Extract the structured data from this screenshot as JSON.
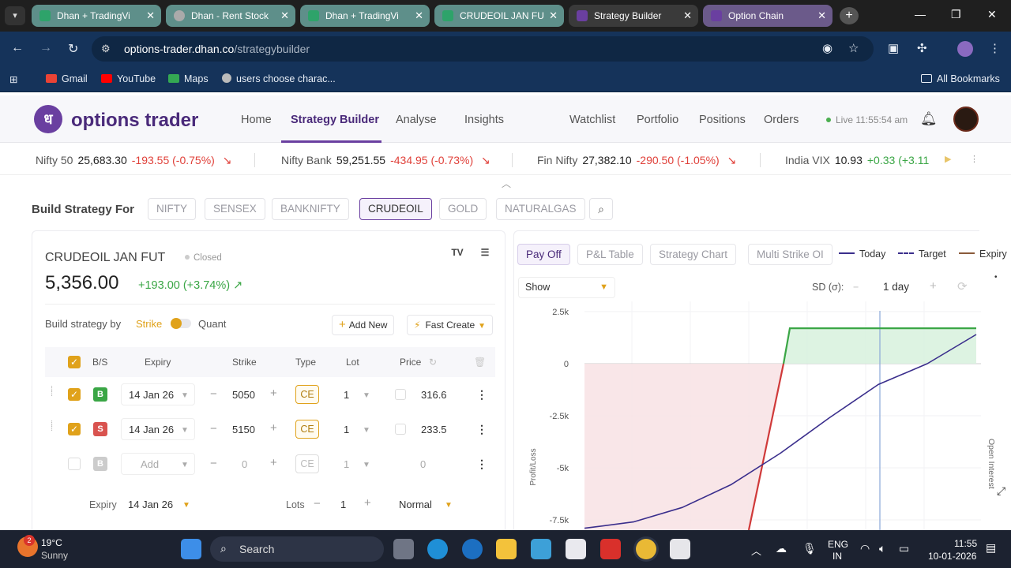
{
  "browser": {
    "tabs": [
      {
        "title": "Dhan + TradingVi",
        "active": false
      },
      {
        "title": "Dhan - Rent Stock",
        "active": false
      },
      {
        "title": "Dhan + TradingVi",
        "active": false
      },
      {
        "title": "CRUDEOIL JAN FU",
        "active": false
      },
      {
        "title": "Strategy Builder",
        "active": true
      },
      {
        "title": "Option Chain",
        "active": false
      }
    ],
    "url_host": "options-trader.dhan.co",
    "url_path": "/strategybuilder",
    "bookmarks": [
      "Gmail",
      "YouTube",
      "Maps",
      "users choose charac..."
    ],
    "all_bookmarks": "All Bookmarks"
  },
  "app": {
    "logo_mark": "ध",
    "logo_text": "options trader",
    "nav": [
      "Home",
      "Strategy Builder",
      "Analyse",
      "Insights",
      "Watchlist",
      "Portfolio",
      "Positions",
      "Orders"
    ],
    "live_status": "Live 11:55:54 am"
  },
  "ticker": [
    {
      "name": "Nifty 50",
      "value": "25,683.30",
      "change": "-193.55 (-0.75%)",
      "dir": "down"
    },
    {
      "name": "Nifty Bank",
      "value": "59,251.55",
      "change": "-434.95 (-0.73%)",
      "dir": "down"
    },
    {
      "name": "Fin Nifty",
      "value": "27,382.10",
      "change": "-290.50 (-1.05%)",
      "dir": "down"
    },
    {
      "name": "India VIX",
      "value": "10.93",
      "change": "+0.33 (+3.11",
      "dir": "up"
    }
  ],
  "build": {
    "label": "Build Strategy For",
    "instruments": [
      "NIFTY",
      "SENSEX",
      "BANKNIFTY",
      "CRUDEOIL",
      "GOLD",
      "NATURALGAS"
    ],
    "selected": "CRUDEOIL"
  },
  "instrument": {
    "symbol": "CRUDEOIL JAN FUT",
    "status": "Closed",
    "ltp": "5,356.00",
    "change": "+193.00 (+3.74%)"
  },
  "builder": {
    "build_by_label": "Build strategy by",
    "mode_strike": "Strike",
    "mode_quant": "Quant",
    "add_new": "Add New",
    "fast_create": "Fast Create",
    "headers": [
      "B/S",
      "Expiry",
      "Strike",
      "Type",
      "Lot",
      "Price"
    ],
    "legs": [
      {
        "checked": true,
        "side": "B",
        "expiry": "14 Jan 26",
        "strike": "5050",
        "type": "CE",
        "lot": "1",
        "price": "316.6"
      },
      {
        "checked": true,
        "side": "S",
        "expiry": "14 Jan 26",
        "strike": "5150",
        "type": "CE",
        "lot": "1",
        "price": "233.5"
      },
      {
        "checked": false,
        "side": "B",
        "expiry": "Add",
        "strike": "0",
        "type": "CE",
        "lot": "1",
        "price": "0"
      }
    ],
    "footer": {
      "expiry_label": "Expiry",
      "expiry": "14 Jan 26",
      "lots_label": "Lots",
      "lots": "1",
      "order_type": "Normal"
    }
  },
  "payoff": {
    "tabs": [
      "Pay Off",
      "P&L Table",
      "Strategy Chart",
      "Multi Strike OI"
    ],
    "active_tab": "Pay Off",
    "legend": [
      "Today",
      "Target",
      "Expiry"
    ],
    "show_select": "Show",
    "sd_label": "SD (σ):",
    "sd_value": "1 day",
    "side_label": "Open Interest"
  },
  "chart_data": {
    "type": "line",
    "ylabel": "Profit/Loss",
    "y_ticks": [
      "2.5k",
      "0",
      "-2.5k",
      "-5k",
      "-7.5k"
    ],
    "y_tick_values": [
      2500,
      0,
      -2500,
      -5000,
      -7500
    ],
    "ylim": [
      -7500,
      2500
    ],
    "series": [
      {
        "name": "Expiry",
        "color": "#3aa645",
        "note": "payoff at expiry, capped max profit",
        "values": [
          -8500,
          -6000,
          -3500,
          0,
          1700,
          1700,
          1700,
          1700,
          1700
        ]
      },
      {
        "name": "Today",
        "color": "#3a2e8c",
        "values": [
          -7900,
          -7600,
          -6900,
          -5800,
          -4300,
          -2600,
          -1000,
          0,
          1400
        ]
      }
    ],
    "colors": {
      "profit_fill": "#d9f2df",
      "loss_fill": "#f8e3e6",
      "loss_line": "#d03a3a",
      "profit_line": "#3aa645",
      "target": "#8aa8d8"
    }
  },
  "taskbar": {
    "weather_temp": "19°C",
    "weather_cond": "Sunny",
    "weather_badge": "2",
    "search": "Search",
    "lang_1": "ENG",
    "lang_2": "IN",
    "time": "11:55",
    "date": "10-01-2026"
  }
}
